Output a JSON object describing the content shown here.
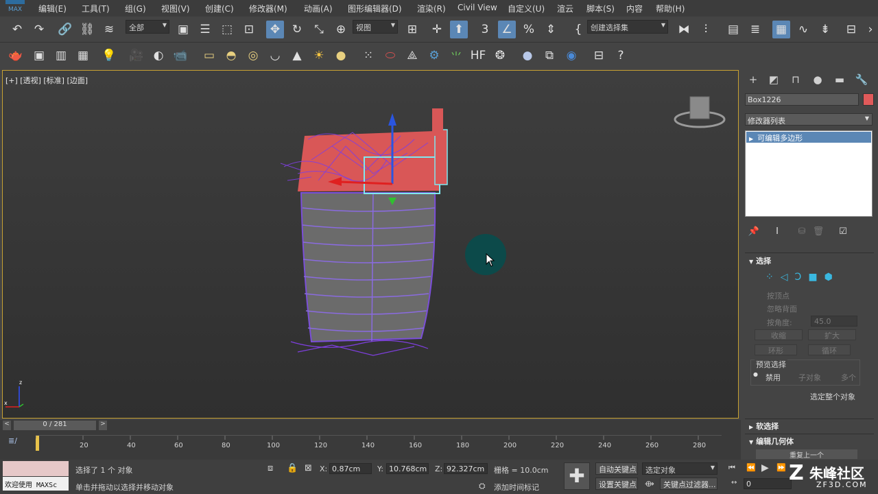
{
  "menubar": {
    "items": [
      "编辑(E)",
      "工具(T)",
      "组(G)",
      "视图(V)",
      "创建(C)",
      "修改器(M)",
      "动画(A)",
      "图形编辑器(D)",
      "渲染(R)",
      "Civil View",
      "自定义(U)",
      "渲云",
      "脚本(S)",
      "内容",
      "帮助(H)"
    ]
  },
  "toolbar": {
    "selection_filter": "全部",
    "ref_coord": "视图",
    "named_selection": "创建选择集"
  },
  "viewport": {
    "label": "[+] [透视] [标准] [边面]",
    "axis_z": "z",
    "axis_x": "x"
  },
  "command_panel": {
    "object_name": "Box1226",
    "object_color": "#e05a5a",
    "modifier_list": "修改器列表",
    "stack_item": "可编辑多边形",
    "selection": {
      "title": "选择",
      "by_vertex": "按顶点",
      "ignore_backfacing": "忽略背面",
      "by_angle": "按角度:",
      "angle_value": "45.0",
      "shrink": "收缩",
      "grow": "扩大",
      "ring": "环形",
      "loop": "循环",
      "preview_title": "预览选择",
      "preview_off": "禁用",
      "preview_subobj": "子对象",
      "preview_multi": "多个",
      "select_whole": "选定整个对象"
    },
    "soft_selection": "软选择",
    "edit_geometry": "编辑几何体",
    "repeat_last": "重复上一个"
  },
  "timeline": {
    "frame_counter": "0 / 281",
    "ticks": [
      "20",
      "40",
      "60",
      "80",
      "100",
      "120",
      "140",
      "160",
      "180",
      "200",
      "220",
      "240",
      "260",
      "280"
    ]
  },
  "status": {
    "maxscript": "欢迎使用 MAXSc",
    "selected": "选择了 1 个 对象",
    "prompt": "单击并拖动以选择并移动对象",
    "x_label": "X:",
    "x_value": "0.87cm",
    "y_label": "Y:",
    "y_value": "10.768cm",
    "z_label": "Z:",
    "z_value": "92.327cm",
    "grid": "栅格 = 10.0cm",
    "add_time_tag": "添加时间标记",
    "auto_key": "自动关键点",
    "set_key": "设置关键点",
    "selected_object": "选定对象",
    "key_filters": "关键点过滤器...",
    "current_frame": "0"
  },
  "watermark": "朱峰社区",
  "watermark_url": "ZF3D.COM"
}
